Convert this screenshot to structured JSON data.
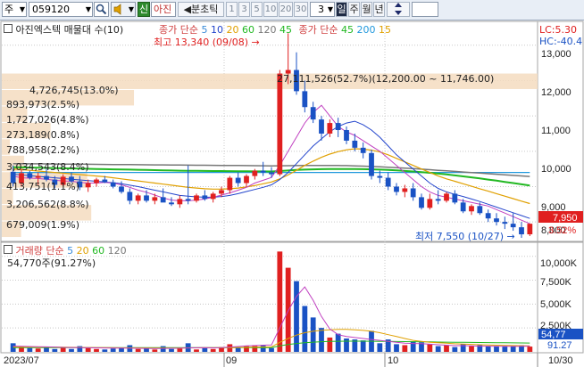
{
  "toolbar": {
    "market_label": "주",
    "code_value": "059120",
    "speaker_icon": "speaker-icon",
    "new_label": "신",
    "name_label": "아진",
    "period_prefix": "◀분초틱",
    "periods": [
      "1",
      "3",
      "5",
      "10",
      "20",
      "30"
    ],
    "count_value": "3",
    "day_label": "일",
    "week_label": "주",
    "month_label": "월",
    "year_label": "년",
    "updown_icon": "up-down-arrow-icon"
  },
  "price_panel": {
    "title": "아진엑스텍 매물대 수(10)",
    "ma_prefix": "종가 단순",
    "ma_items": [
      {
        "label": "5",
        "color": "#3a8bd9"
      },
      {
        "label": "10",
        "color": "#2244cc"
      },
      {
        "label": "20",
        "color": "#e0a000"
      },
      {
        "label": "60",
        "color": "#22b822"
      },
      {
        "label": "120",
        "color": "#777777"
      }
    ],
    "ma2_first": "45",
    "ma2_prefix": "종가 단순",
    "ma2_items": [
      {
        "label": "45",
        "color": "#22b822"
      },
      {
        "label": "200",
        "color": "#2299dd"
      },
      {
        "label": "15",
        "color": "#e0a000"
      }
    ],
    "high_annotation": "최고 13,340 (09/08) →",
    "low_annotation": "최저 7,550 (10/27) →",
    "lc_label": "LC:5.30",
    "hc_label": "HC:-40.4",
    "price_axis": [
      "13,000",
      "12,000",
      "11,000",
      "10,000",
      "9,000",
      "8,000"
    ],
    "current_price": "7,950",
    "current_change": "3.52%",
    "volume_profile": [
      {
        "text": "27,111,526(52.7%)(12,200.00 ~ 11,746.00)",
        "pct": 52.7
      },
      {
        "text": "4,726,745(13.0%)",
        "pct": 13.0
      },
      {
        "text": "893,973(2.5%)",
        "pct": 2.5
      },
      {
        "text": "1,727,026(4.8%)",
        "pct": 4.8
      },
      {
        "text": "273,189(0.8%)",
        "pct": 0.8
      },
      {
        "text": "788,958(2.2%)",
        "pct": 2.2
      },
      {
        "text": "3,034,543(8.4%)",
        "pct": 8.4
      },
      {
        "text": "413,751(1.1%)",
        "pct": 1.1
      },
      {
        "text": "3,206,562(8.8%)",
        "pct": 8.8
      },
      {
        "text": "679,009(1.9%)",
        "pct": 1.9
      }
    ]
  },
  "volume_panel": {
    "title": "거래량",
    "ma_prefix": "단순",
    "ma_items": [
      {
        "label": "5",
        "color": "#3a8bd9"
      },
      {
        "label": "20",
        "color": "#e0a000"
      },
      {
        "label": "60",
        "color": "#22b822"
      },
      {
        "label": "120",
        "color": "#777777"
      }
    ],
    "current_volume": "54,770주(91.27%)",
    "axis": [
      "10,000K",
      "7,500K",
      "5,000K",
      "2,500K"
    ],
    "current_tag": "54,77",
    "current_tag_pct": "91.27"
  },
  "x_axis": {
    "labels": [
      "2023/07",
      "09",
      "10",
      "10/30"
    ]
  },
  "colors": {
    "up": "#e02020",
    "down": "#1a52c4",
    "grid": "#c8c8c8",
    "toolbar_bg": "#e8eef6",
    "vp_bar": "#f5dcc0"
  },
  "chart_data": {
    "type": "candlestick",
    "y_range": [
      7500,
      13600
    ],
    "candles": [
      [
        9420,
        9600,
        9000,
        9100
      ],
      [
        9100,
        9500,
        9000,
        9380
      ],
      [
        9380,
        9450,
        9200,
        9250
      ],
      [
        9250,
        9400,
        9050,
        9300
      ],
      [
        9300,
        9500,
        9150,
        9200
      ],
      [
        9200,
        9300,
        8950,
        9050
      ],
      [
        9050,
        9350,
        9000,
        9280
      ],
      [
        9280,
        9400,
        9100,
        9150
      ],
      [
        9150,
        9300,
        8900,
        8980
      ],
      [
        8980,
        9200,
        8850,
        9100
      ],
      [
        9100,
        9250,
        9000,
        9200
      ],
      [
        9200,
        9300,
        9100,
        9120
      ],
      [
        9120,
        9200,
        8950,
        9000
      ],
      [
        9000,
        9150,
        8800,
        8850
      ],
      [
        8850,
        8950,
        8500,
        8600
      ],
      [
        8600,
        8800,
        8500,
        8750
      ],
      [
        8750,
        8900,
        8550,
        8600
      ],
      [
        8600,
        8800,
        8500,
        8700
      ],
      [
        8700,
        8950,
        8600,
        8550
      ],
      [
        8550,
        8700,
        8450,
        8500
      ],
      [
        8500,
        8750,
        8400,
        8650
      ],
      [
        8650,
        9600,
        8500,
        8600
      ],
      [
        8600,
        8800,
        8550,
        8750
      ],
      [
        8750,
        8900,
        8600,
        8650
      ],
      [
        8650,
        8850,
        8550,
        8800
      ],
      [
        8800,
        9000,
        8700,
        8900
      ],
      [
        8900,
        9300,
        8800,
        9250
      ],
      [
        9250,
        9400,
        9000,
        9100
      ],
      [
        9100,
        9350,
        9000,
        9300
      ],
      [
        9300,
        9500,
        9200,
        9450
      ],
      [
        9450,
        9700,
        9300,
        9400
      ],
      [
        9400,
        9550,
        9250,
        9350
      ],
      [
        9350,
        12300,
        9300,
        12200
      ],
      [
        12200,
        13340,
        11900,
        12300
      ],
      [
        12300,
        12800,
        11600,
        11700
      ],
      [
        11700,
        12000,
        11100,
        11250
      ],
      [
        11250,
        11400,
        10800,
        10900
      ],
      [
        10900,
        11000,
        10300,
        10500
      ],
      [
        10500,
        10900,
        10400,
        10800
      ],
      [
        10800,
        10950,
        10400,
        10600
      ],
      [
        10600,
        10700,
        10200,
        10300
      ],
      [
        10300,
        10500,
        10000,
        10100
      ],
      [
        10100,
        10250,
        9800,
        9950
      ],
      [
        9950,
        10050,
        9200,
        9300
      ],
      [
        9300,
        9450,
        9100,
        9250
      ],
      [
        9250,
        9400,
        8900,
        9000
      ],
      [
        9000,
        9100,
        8750,
        8850
      ],
      [
        8850,
        9050,
        8700,
        8950
      ],
      [
        8950,
        9100,
        8600,
        8700
      ],
      [
        8700,
        8800,
        8350,
        8400
      ],
      [
        8400,
        8800,
        8350,
        8650
      ],
      [
        8650,
        8900,
        8500,
        8600
      ],
      [
        8600,
        8850,
        8550,
        8800
      ],
      [
        8800,
        8900,
        8500,
        8550
      ],
      [
        8550,
        8650,
        8250,
        8300
      ],
      [
        8300,
        8500,
        8200,
        8450
      ],
      [
        8450,
        8550,
        8200,
        8250
      ],
      [
        8250,
        8350,
        8000,
        8100
      ],
      [
        8100,
        8250,
        7900,
        8000
      ],
      [
        8000,
        8150,
        7800,
        7950
      ],
      [
        7950,
        8250,
        7750,
        7850
      ],
      [
        7850,
        8000,
        7550,
        7650
      ],
      [
        7650,
        7950,
        7600,
        7950
      ]
    ],
    "ma5": [
      9300,
      9250,
      9240,
      9230,
      9210,
      9180,
      9160,
      9150,
      9120,
      9100,
      9100,
      9120,
      9100,
      9050,
      8980,
      8900,
      8840,
      8760,
      8680,
      8620,
      8600,
      8600,
      8620,
      8650,
      8700,
      8760,
      8820,
      8900,
      8980,
      9100,
      9180,
      9260,
      9600,
      10000,
      10400,
      10800,
      11100,
      11300,
      11000,
      10700,
      10550,
      10450,
      10300,
      10150,
      10000,
      9800,
      9600,
      9400,
      9200,
      9000,
      8850,
      8750,
      8700,
      8650,
      8600,
      8550,
      8500,
      8450,
      8350,
      8250,
      8150,
      8050,
      7950
    ],
    "ma10": [
      9350,
      9330,
      9310,
      9290,
      9270,
      9250,
      9230,
      9210,
      9190,
      9170,
      9150,
      9130,
      9110,
      9080,
      9040,
      9000,
      8950,
      8900,
      8850,
      8800,
      8750,
      8730,
      8710,
      8700,
      8700,
      8720,
      8750,
      8800,
      8860,
      8920,
      8980,
      9050,
      9200,
      9400,
      9650,
      9900,
      10150,
      10350,
      10550,
      10700,
      10800,
      10850,
      10750,
      10600,
      10400,
      10150,
      9900,
      9700,
      9500,
      9300,
      9100,
      8950,
      8850,
      8780,
      8720,
      8650,
      8580,
      8500,
      8420,
      8340,
      8260,
      8180,
      8100
    ],
    "ma20": [
      9500,
      9480,
      9460,
      9440,
      9420,
      9400,
      9380,
      9360,
      9340,
      9320,
      9300,
      9280,
      9250,
      9220,
      9190,
      9160,
      9130,
      9100,
      9070,
      9040,
      9010,
      8980,
      8960,
      8940,
      8930,
      8930,
      8940,
      8960,
      8990,
      9030,
      9080,
      9130,
      9220,
      9330,
      9460,
      9600,
      9720,
      9830,
      9920,
      9990,
      10040,
      10070,
      10060,
      10030,
      9980,
      9900,
      9800,
      9700,
      9600,
      9500,
      9400,
      9300,
      9220,
      9150,
      9080,
      9010,
      8940,
      8870,
      8800,
      8730,
      8660,
      8590,
      8520
    ],
    "ma60": [
      9550,
      9545,
      9540,
      9535,
      9530,
      9525,
      9520,
      9515,
      9510,
      9505,
      9500,
      9495,
      9490,
      9485,
      9480,
      9475,
      9470,
      9465,
      9460,
      9455,
      9450,
      9448,
      9446,
      9444,
      9442,
      9440,
      9438,
      9436,
      9434,
      9432,
      9430,
      9428,
      9440,
      9455,
      9470,
      9480,
      9488,
      9494,
      9498,
      9500,
      9500,
      9498,
      9494,
      9488,
      9480,
      9470,
      9458,
      9444,
      9428,
      9410,
      9390,
      9368,
      9344,
      9318,
      9290,
      9262,
      9232,
      9200,
      9168,
      9134,
      9100,
      9066,
      9030
    ],
    "ma120": [
      9650,
      9648,
      9646,
      9644,
      9642,
      9640,
      9638,
      9636,
      9634,
      9632,
      9630,
      9628,
      9626,
      9624,
      9622,
      9620,
      9618,
      9616,
      9614,
      9612,
      9610,
      9608,
      9606,
      9604,
      9602,
      9600,
      9598,
      9596,
      9594,
      9592,
      9590,
      9588,
      9590,
      9592,
      9594,
      9596,
      9598,
      9600,
      9600,
      9598,
      9594,
      9588,
      9580,
      9570,
      9560,
      9548,
      9536,
      9522,
      9508,
      9494,
      9478,
      9462,
      9446,
      9430,
      9414,
      9398,
      9382,
      9366,
      9350,
      9334,
      9318,
      9302,
      9286
    ],
    "ma200": [
      9400,
      9400,
      9400,
      9400,
      9400,
      9400,
      9400,
      9400,
      9400,
      9400,
      9400,
      9400,
      9400,
      9400,
      9400,
      9400,
      9400,
      9400,
      9400,
      9400,
      9400,
      9400,
      9400,
      9400,
      9400,
      9400,
      9400,
      9400,
      9400,
      9400,
      9400,
      9400,
      9400,
      9400,
      9400,
      9400,
      9400,
      9400,
      9400,
      9400,
      9400,
      9400,
      9400,
      9400,
      9400,
      9400,
      9400,
      9400,
      9400,
      9400,
      9400,
      9400,
      9400,
      9400,
      9400,
      9400,
      9400,
      9400,
      9400,
      9400,
      9400,
      9400,
      9400
    ],
    "volumes_k": [
      900,
      600,
      400,
      350,
      500,
      300,
      450,
      300,
      600,
      400,
      300,
      250,
      350,
      400,
      700,
      300,
      350,
      250,
      600,
      300,
      350,
      900,
      250,
      400,
      300,
      500,
      800,
      450,
      600,
      700,
      650,
      400,
      10500,
      8800,
      7400,
      4800,
      3600,
      2500,
      1500,
      1900,
      1400,
      1300,
      1200,
      2200,
      900,
      1300,
      800,
      700,
      1100,
      1000,
      800,
      600,
      700,
      500,
      800,
      600,
      700,
      600,
      600,
      550,
      600,
      700,
      550
    ],
    "vol_ma5": [
      600,
      580,
      560,
      540,
      520,
      500,
      470,
      460,
      440,
      430,
      420,
      410,
      400,
      390,
      380,
      370,
      360,
      350,
      360,
      370,
      380,
      420,
      430,
      440,
      420,
      450,
      500,
      560,
      620,
      650,
      700,
      720,
      2500,
      4300,
      5800,
      6800,
      5400,
      3700,
      2400,
      1800,
      1600,
      1500,
      1400,
      1300,
      1200,
      1100,
      1000,
      900,
      880,
      860,
      800,
      750,
      700,
      650,
      650,
      620,
      600,
      600,
      580,
      580,
      570,
      580,
      600
    ],
    "vol_ma20": [
      500,
      500,
      500,
      500,
      500,
      500,
      490,
      480,
      470,
      460,
      450,
      440,
      430,
      420,
      420,
      410,
      410,
      400,
      400,
      400,
      400,
      410,
      420,
      430,
      430,
      440,
      450,
      460,
      480,
      500,
      510,
      520,
      1000,
      1400,
      1750,
      2000,
      2150,
      2250,
      2300,
      2350,
      2350,
      2300,
      2250,
      2150,
      2000,
      1800,
      1600,
      1400,
      1200,
      1100,
      1000,
      950,
      900,
      850,
      820,
      780,
      750,
      720,
      700,
      680,
      660,
      640,
      620
    ],
    "vol_ma60": [
      450,
      450,
      450,
      450,
      450,
      450,
      450,
      450,
      450,
      450,
      450,
      450,
      450,
      450,
      450,
      450,
      450,
      450,
      450,
      450,
      450,
      450,
      450,
      450,
      450,
      450,
      450,
      450,
      450,
      450,
      450,
      450,
      620,
      760,
      880,
      960,
      1020,
      1060,
      1090,
      1110,
      1120,
      1120,
      1120,
      1110,
      1100,
      1090,
      1080,
      1070,
      1060,
      1050,
      1040,
      1030,
      1020,
      1010,
      1000,
      990,
      980,
      970,
      960,
      950,
      940,
      930,
      920
    ]
  }
}
